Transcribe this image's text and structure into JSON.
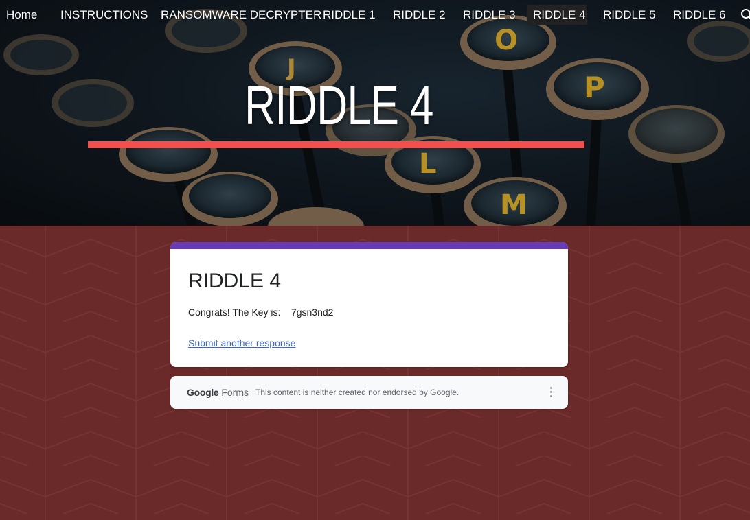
{
  "nav": {
    "items": [
      {
        "label": "Home"
      },
      {
        "label": "INSTRUCTIONS"
      },
      {
        "label": "RANSOMWARE DECRYPTER"
      },
      {
        "label": "RIDDLE 1"
      },
      {
        "label": "RIDDLE 2"
      },
      {
        "label": "RIDDLE 3"
      },
      {
        "label": "RIDDLE 4",
        "active": true
      },
      {
        "label": "RIDDLE 5"
      },
      {
        "label": "RIDDLE 6"
      }
    ],
    "search_icon": "search-icon"
  },
  "hero": {
    "title": "RIDDLE 4",
    "key_letters": [
      "O",
      "P",
      "J",
      "L",
      "M"
    ],
    "accent_color": "#f2504f"
  },
  "form": {
    "title": "RIDDLE 4",
    "message": "Congrats! The Key is:    7gsn3nd2",
    "link": "Submit another response",
    "accent_color": "#673ab7"
  },
  "footer": {
    "brand_google": "Google",
    "brand_forms": "Forms",
    "note": "This content is neither created nor endorsed by Google.",
    "menu_icon": "more-vert-icon"
  },
  "colors": {
    "background": "#6b2a2a",
    "link": "#3c68c4"
  }
}
